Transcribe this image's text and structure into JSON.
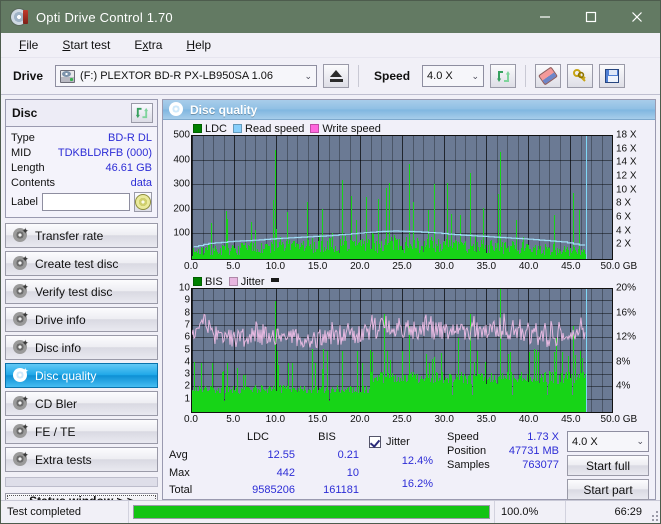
{
  "window": {
    "title": "Opti Drive Control 1.70",
    "app_icon": "disc-icon",
    "minimize": "–",
    "maximize": "□",
    "close": "✕"
  },
  "menu": {
    "items": [
      {
        "label": "File"
      },
      {
        "label": "Start test"
      },
      {
        "label": "Extra"
      },
      {
        "label": "Help"
      }
    ]
  },
  "toolbar": {
    "drive_label": "Drive",
    "drive_value": "(F:)  PLEXTOR BD-R  PX-LB950SA 1.06",
    "eject_icon": "eject-icon",
    "speed_label": "Speed",
    "speed_value": "4.0 X",
    "refresh_icon": "refresh-icon",
    "eraser_icon": "eraser-icon",
    "keys_icon": "keys-icon",
    "save_icon": "floppy-save-icon"
  },
  "disc_panel": {
    "title": "Disc",
    "refresh_icon": "refresh-disc-icon",
    "rows": [
      {
        "key": "Type",
        "value": "BD-R DL"
      },
      {
        "key": "MID",
        "value": "TDKBLDRFB (000)"
      },
      {
        "key": "Length",
        "value": "46.61 GB"
      },
      {
        "key": "Contents",
        "value": "data"
      }
    ],
    "label_key": "Label",
    "label_value": "",
    "label_placeholder": "",
    "label_button_icon": "cd-disc-icon"
  },
  "nav": {
    "items": [
      {
        "label": "Transfer rate",
        "icon": "disc-icon",
        "active": false
      },
      {
        "label": "Create test disc",
        "icon": "disc-icon",
        "active": false
      },
      {
        "label": "Verify test disc",
        "icon": "disc-icon",
        "active": false
      },
      {
        "label": "Drive info",
        "icon": "disc-icon",
        "active": false
      },
      {
        "label": "Disc info",
        "icon": "disc-icon",
        "active": false
      },
      {
        "label": "Disc quality",
        "icon": "disc-icon",
        "active": true
      },
      {
        "label": "CD Bler",
        "icon": "disc-icon",
        "active": false
      },
      {
        "label": "FE / TE",
        "icon": "disc-icon",
        "active": false
      },
      {
        "label": "Extra tests",
        "icon": "disc-icon",
        "active": false
      }
    ],
    "status_window": "Status window > >"
  },
  "panel": {
    "title": "Disc quality",
    "icon": "disc-quality-icon"
  },
  "chart_data": [
    {
      "type": "bar",
      "title": "LDC / Read speed",
      "xlabel": "GB",
      "ylabel": "",
      "xlim": [
        0,
        50
      ],
      "ylim": [
        0,
        500
      ],
      "y2lim": [
        0,
        18
      ],
      "grid": true,
      "legend_position": "top-left",
      "legend": [
        {
          "label": "LDC",
          "color": "#008000"
        },
        {
          "label": "Read speed",
          "color": "#87cefa"
        },
        {
          "label": "Write speed",
          "color": "#ff66dd"
        }
      ],
      "xticks": [
        "0.0",
        "5.0",
        "10.0",
        "15.0",
        "20.0",
        "25.0",
        "30.0",
        "35.0",
        "40.0",
        "45.0",
        "50.0"
      ],
      "yticks": [
        "100",
        "200",
        "300",
        "400",
        "500"
      ],
      "y2ticks": [
        "2 X",
        "4 X",
        "6 X",
        "8 X",
        "10 X",
        "12 X",
        "14 X",
        "16 X",
        "18 X"
      ],
      "x_unit": "GB",
      "data_end_gb": 46.9,
      "series": [
        {
          "name": "LDC",
          "color": "#17d417",
          "baseline": [
            30,
            34,
            28,
            32,
            40,
            30,
            26,
            35,
            28,
            38,
            30,
            26,
            34,
            30,
            28,
            42,
            30,
            26,
            32,
            36,
            30,
            28,
            44,
            36,
            30,
            26,
            34,
            30,
            40,
            28,
            32,
            36,
            30,
            26,
            38,
            34,
            30,
            28,
            46,
            30,
            34,
            26,
            32,
            38,
            30,
            44,
            28,
            34,
            30,
            26,
            36,
            30,
            42,
            28,
            32,
            34,
            30,
            26,
            38,
            30,
            34,
            28,
            44,
            30,
            36,
            26,
            32,
            40,
            30,
            28,
            34,
            46,
            30,
            32,
            26,
            38,
            30,
            34,
            28,
            42,
            30,
            26,
            36,
            32,
            30,
            40,
            28,
            34,
            30,
            26,
            44,
            30,
            32,
            36,
            28,
            30,
            38,
            26,
            34,
            30
          ],
          "spikes": [
            {
              "gb": 2.3,
              "v": 148
            },
            {
              "gb": 7.5,
              "v": 118
            },
            {
              "gb": 9.9,
              "v": 443
            },
            {
              "gb": 9.6,
              "v": 240
            },
            {
              "gb": 11.3,
              "v": 192
            },
            {
              "gb": 13.7,
              "v": 232
            },
            {
              "gb": 15.5,
              "v": 205
            },
            {
              "gb": 17.8,
              "v": 321
            },
            {
              "gb": 18.9,
              "v": 258
            },
            {
              "gb": 19.5,
              "v": 160
            },
            {
              "gb": 20.7,
              "v": 253
            },
            {
              "gb": 22.1,
              "v": 243
            },
            {
              "gb": 23.1,
              "v": 289
            },
            {
              "gb": 23.5,
              "v": 309
            },
            {
              "gb": 25.8,
              "v": 386
            },
            {
              "gb": 26.3,
              "v": 230
            },
            {
              "gb": 28.8,
              "v": 303
            },
            {
              "gb": 30.4,
              "v": 310
            },
            {
              "gb": 33.1,
              "v": 348
            },
            {
              "gb": 34.6,
              "v": 208
            },
            {
              "gb": 36.7,
              "v": 434
            },
            {
              "gb": 36.4,
              "v": 264
            },
            {
              "gb": 38.6,
              "v": 158
            },
            {
              "gb": 43.1,
              "v": 178
            },
            {
              "gb": 45.4,
              "v": 268
            },
            {
              "gb": 46.1,
              "v": 200
            }
          ]
        },
        {
          "name": "Read speed",
          "color": "#9fdcf5",
          "points": [
            {
              "gb": 0.2,
              "x": 1.8
            },
            {
              "gb": 2.0,
              "x": 2.3
            },
            {
              "gb": 5.0,
              "x": 2.6
            },
            {
              "gb": 8.0,
              "x": 2.8
            },
            {
              "gb": 10.0,
              "x": 3.0
            },
            {
              "gb": 13.0,
              "x": 3.2
            },
            {
              "gb": 16.0,
              "x": 3.4
            },
            {
              "gb": 19.0,
              "x": 3.7
            },
            {
              "gb": 22.0,
              "x": 4.0
            },
            {
              "gb": 24.0,
              "x": 4.1
            },
            {
              "gb": 26.5,
              "x": 4.0
            },
            {
              "gb": 29.0,
              "x": 3.8
            },
            {
              "gb": 32.0,
              "x": 3.5
            },
            {
              "gb": 36.0,
              "x": 3.2
            },
            {
              "gb": 40.0,
              "x": 2.9
            },
            {
              "gb": 44.0,
              "x": 2.5
            },
            {
              "gb": 46.8,
              "x": 1.9
            }
          ]
        }
      ]
    },
    {
      "type": "bar",
      "title": "BIS / Jitter",
      "xlabel": "GB",
      "xlim": [
        0,
        50
      ],
      "ylim": [
        0,
        10
      ],
      "y2lim": [
        0,
        20
      ],
      "grid": true,
      "legend_position": "top-left",
      "legend": [
        {
          "label": "BIS",
          "color": "#008000"
        },
        {
          "label": "Jitter",
          "color": "#e8b6e0"
        }
      ],
      "xticks": [
        "0.0",
        "5.0",
        "10.0",
        "15.0",
        "20.0",
        "25.0",
        "30.0",
        "35.0",
        "40.0",
        "45.0",
        "50.0"
      ],
      "yticks": [
        "1",
        "2",
        "3",
        "4",
        "5",
        "6",
        "7",
        "8",
        "9",
        "10"
      ],
      "y2ticks": [
        "4%",
        "8%",
        "12%",
        "16%",
        "20%"
      ],
      "x_unit": "GB",
      "data_end_gb": 46.9,
      "series": [
        {
          "name": "BIS",
          "color": "#17d417",
          "baseline_left": 2.0,
          "baseline_right": 3.0,
          "spikes": [
            {
              "gb": 1.1,
              "v": 4
            },
            {
              "gb": 2.4,
              "v": 4
            },
            {
              "gb": 4.2,
              "v": 4
            },
            {
              "gb": 6.1,
              "v": 3
            },
            {
              "gb": 9.9,
              "v": 9
            },
            {
              "gb": 10.1,
              "v": 5
            },
            {
              "gb": 11.9,
              "v": 4
            },
            {
              "gb": 14.6,
              "v": 4
            },
            {
              "gb": 16.1,
              "v": 5
            },
            {
              "gb": 17.8,
              "v": 5
            },
            {
              "gb": 19.6,
              "v": 5
            },
            {
              "gb": 22.9,
              "v": 8
            },
            {
              "gb": 23.2,
              "v": 5
            },
            {
              "gb": 25.8,
              "v": 7
            },
            {
              "gb": 28.2,
              "v": 4
            },
            {
              "gb": 33.1,
              "v": 8
            },
            {
              "gb": 36.7,
              "v": 10
            },
            {
              "gb": 40.9,
              "v": 4
            },
            {
              "gb": 45.3,
              "v": 7
            },
            {
              "gb": 46.2,
              "v": 5
            }
          ]
        },
        {
          "name": "Jitter",
          "color": "#e5b8e0",
          "avg_pct": 12.4,
          "max_pct": 16.2,
          "points": [
            {
              "gb": 0.2,
              "v": 6.6
            },
            {
              "gb": 1.2,
              "v": 7.3
            },
            {
              "gb": 2.5,
              "v": 6.2
            },
            {
              "gb": 4.0,
              "v": 5.8
            },
            {
              "gb": 6.0,
              "v": 5.9
            },
            {
              "gb": 8.0,
              "v": 6.0
            },
            {
              "gb": 10.0,
              "v": 6.1
            },
            {
              "gb": 12.0,
              "v": 5.9
            },
            {
              "gb": 14.0,
              "v": 5.8
            },
            {
              "gb": 16.0,
              "v": 5.9
            },
            {
              "gb": 18.0,
              "v": 6.0
            },
            {
              "gb": 20.0,
              "v": 6.2
            },
            {
              "gb": 22.0,
              "v": 6.6
            },
            {
              "gb": 23.2,
              "v": 7.0
            },
            {
              "gb": 25.0,
              "v": 6.5
            },
            {
              "gb": 28.0,
              "v": 6.5
            },
            {
              "gb": 32.0,
              "v": 6.5
            },
            {
              "gb": 36.0,
              "v": 6.5
            },
            {
              "gb": 39.0,
              "v": 6.3
            },
            {
              "gb": 41.0,
              "v": 5.9
            },
            {
              "gb": 43.0,
              "v": 5.9
            },
            {
              "gb": 45.0,
              "v": 6.2
            },
            {
              "gb": 46.6,
              "v": 6.5
            }
          ]
        }
      ]
    }
  ],
  "stats": {
    "col_headers": [
      "LDC",
      "BIS"
    ],
    "rows": [
      {
        "label": "Avg",
        "ldc": "12.55",
        "bis": "0.21"
      },
      {
        "label": "Max",
        "ldc": "442",
        "bis": "10"
      },
      {
        "label": "Total",
        "ldc": "9585206",
        "bis": "161181"
      }
    ],
    "jitter": {
      "checkbox_label": "Jitter",
      "checked": true,
      "avg": "12.4%",
      "max": "16.2%"
    },
    "speed_label": "Speed",
    "speed_value": "1.73 X",
    "position_label": "Position",
    "position_value": "47731 MB",
    "samples_label": "Samples",
    "samples_value": "763077",
    "speed_select": "4.0 X",
    "start_full": "Start full",
    "start_part": "Start part"
  },
  "statusbar": {
    "message": "Test completed",
    "progress_pct": 100.0,
    "progress_text": "100.0%",
    "elapsed": "66:29"
  },
  "colors": {
    "title_bar": "#637a63",
    "accent_blue": "#2d2dd6",
    "plot_bg": "#6b7a94",
    "green": "#17d417",
    "cyan": "#9fdcf5",
    "pink": "#e5b8e0",
    "selected_nav": "#1ea7e8",
    "progress_green": "#13c413"
  }
}
